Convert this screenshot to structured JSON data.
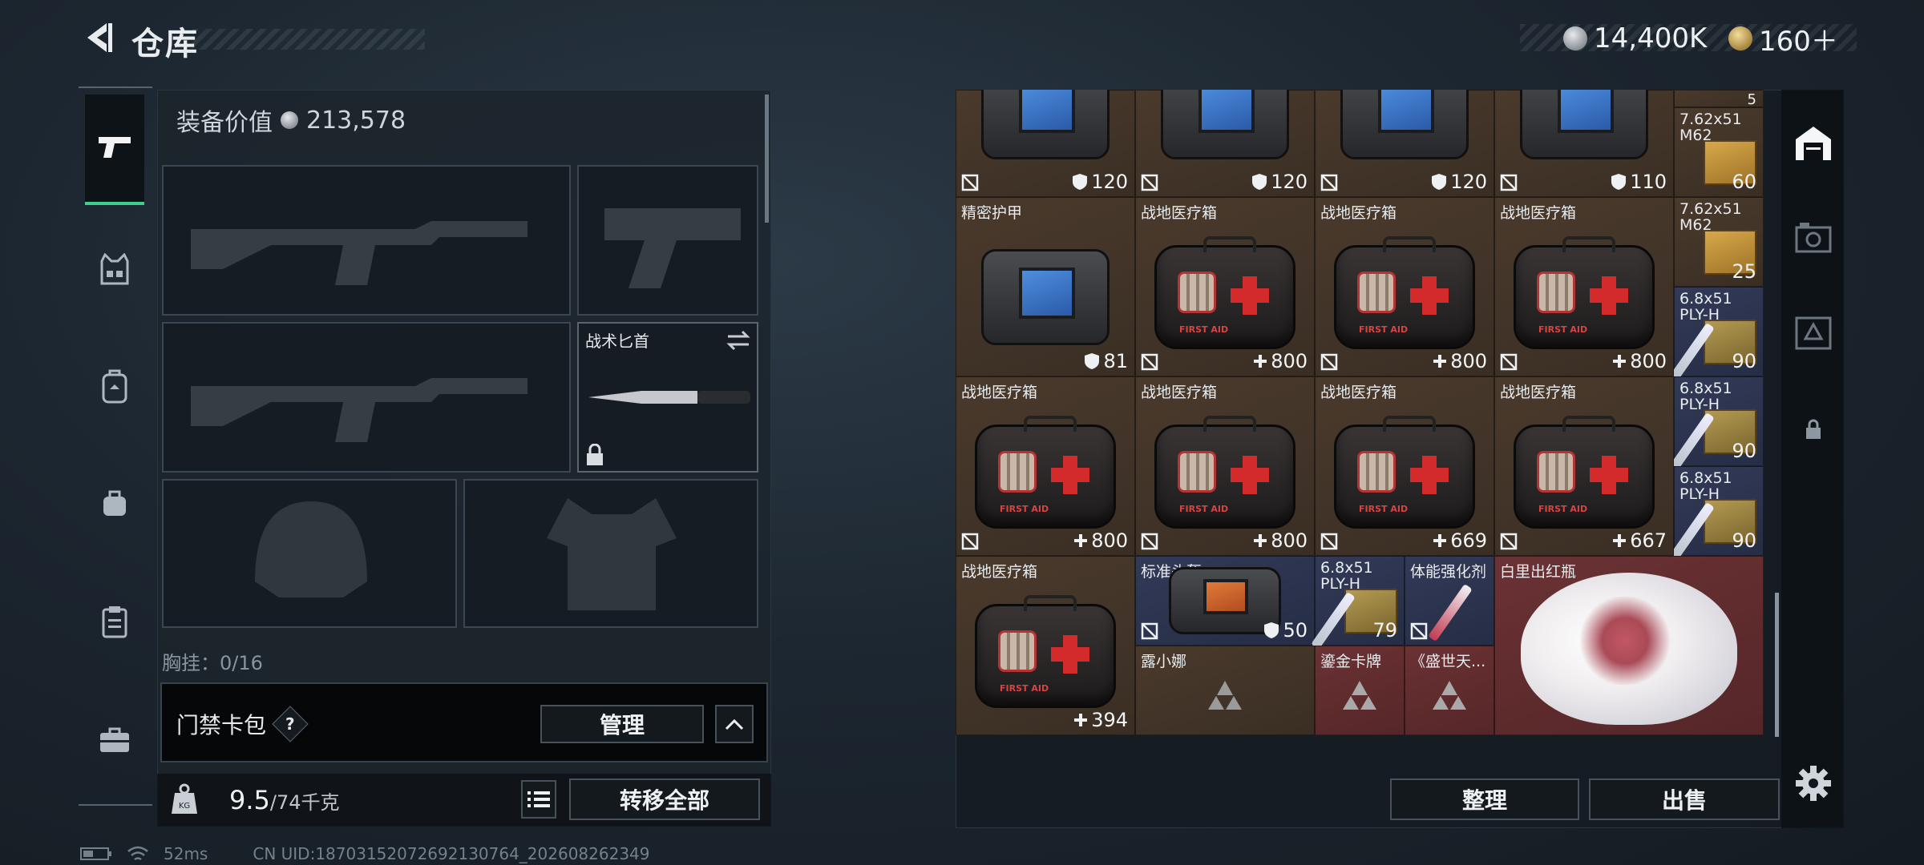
{
  "header": {
    "title": "仓库",
    "silver": "14,400K",
    "gold": "160＋"
  },
  "equipment": {
    "value_label": "装备价值",
    "value": "213,578",
    "knife_name": "战术匕首",
    "chest_label": "胸挂：0/16",
    "cardpack_label": "门禁卡包",
    "manage_label": "管理",
    "weight_current": "9.5",
    "weight_max": "/74千克",
    "transfer_label": "转移全部",
    "weight_icon_text": "KG"
  },
  "status": {
    "ping": "52ms",
    "uid": "CN UID:18703152072692130764_202608262349"
  },
  "stash": {
    "sort_label": "整理",
    "sell_label": "出售",
    "row0": [
      {
        "val": "120"
      },
      {
        "val": "120"
      },
      {
        "val": "120"
      },
      {
        "val": "110"
      }
    ],
    "ammo_top_count": "5",
    "ammo": [
      {
        "name": "7.62x51 M62",
        "count": "60"
      },
      {
        "name": "7.62x51 M62",
        "count": "25"
      },
      {
        "name": "6.8x51 PLY-H",
        "count": "90"
      },
      {
        "name": "6.8x51 PLY-H",
        "count": "90"
      },
      {
        "name": "6.8x51 PLY-H",
        "count": "90"
      }
    ],
    "row1": [
      {
        "name": "精密护甲",
        "val": "81"
      },
      {
        "name": "战地医疗箱",
        "val": "800"
      },
      {
        "name": "战地医疗箱",
        "val": "800"
      },
      {
        "name": "战地医疗箱",
        "val": "800"
      }
    ],
    "row2": [
      {
        "name": "战地医疗箱",
        "val": "800"
      },
      {
        "name": "战地医疗箱",
        "val": "800"
      },
      {
        "name": "战地医疗箱",
        "val": "669"
      },
      {
        "name": "战地医疗箱",
        "val": "667"
      }
    ],
    "row3": {
      "medkit": {
        "name": "战地医疗箱",
        "val": "394"
      },
      "helmet": {
        "name": "标准头盔",
        "val": "50"
      },
      "ammo": {
        "name": "6.8x51 PLY-H",
        "count": "79"
      },
      "stim": {
        "name": "体能强化剂"
      },
      "vase": {
        "name": "白里出红瓶"
      },
      "card1": {
        "name": "露小娜"
      },
      "card2": {
        "name": "鎏金卡牌"
      },
      "card3": {
        "name": "《盛世天..."
      }
    },
    "medkit_text": "FIRST AID"
  },
  "colors": {
    "accent": "#3ecf8e",
    "brown": "#4a3a2c",
    "blue": "#323a58",
    "red": "#6b3234"
  }
}
